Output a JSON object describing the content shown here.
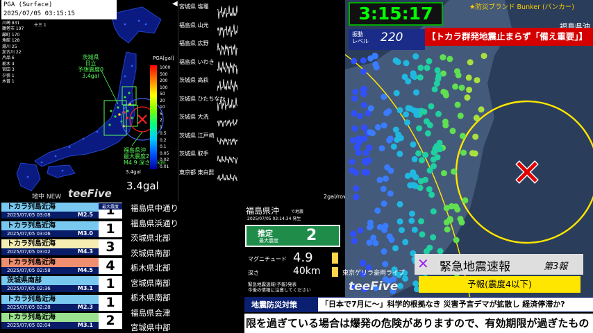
{
  "pga": {
    "title": "PGA (Surface)",
    "timestamp": "2025/07/05 03:15:15",
    "station_counts": [
      "川崎 831",
      "鶴巻市 197",
      "厳町 170",
      "角館 128",
      "湯川 25",
      "加古川 22",
      "片品 6",
      "栃木 4",
      "宮田 3",
      "夕張 1",
      "木曽 1"
    ],
    "top_tag": "十三 1",
    "ibaraki_label": [
      "茨城県",
      "日立",
      "予想震度0",
      "3.4gal"
    ],
    "fukushima_label": [
      "福島県沖",
      "最大震度2",
      "M4.9 深さ40km"
    ],
    "scale_title": "PGA[gal]",
    "scale_ticks": [
      "1000",
      "500",
      "200",
      "100",
      "50",
      "20",
      "10",
      "5",
      "2",
      "1",
      "0.5",
      "0.2",
      "0.1",
      "0.05",
      "0.02",
      "0.01"
    ],
    "min_label": "3.4gal",
    "big_value": "3.4gal",
    "brand_new": "地中 NEW",
    "brand_logo": "teeFive"
  },
  "waveforms": {
    "axis_label": "◀",
    "unit": "2gal/row",
    "stations": [
      "宮城県 塩竈",
      "福島県 山元",
      "福島県 広野",
      "福島県 いわき",
      "茨城県 高萩",
      "茨城県 ひたちなか",
      "茨城県 大洗",
      "茨城県 江戸崎",
      "茨城県 取手",
      "東京都 東白髭"
    ]
  },
  "clock": "3:15:17",
  "shindo_level": {
    "label": [
      "振動",
      "レベル"
    ],
    "value": "220"
  },
  "news_banner": "【トカラ群発地震止まらず「備え重要」】",
  "brand_bunker": "★防災ブランド Bunker (バンカー)",
  "fukushima_off_label": "福島県沖",
  "eew": {
    "title": "緊急地震速報",
    "report": "第3報",
    "forecast": "予報(震度4以下)"
  },
  "eq_info": {
    "region": "福島県沖",
    "region_tag": "で地震",
    "time": "2025/07/05 03:14:34 発生",
    "max_label": "推定",
    "max_sub": "最大震度",
    "max_value": "2",
    "mag_label": "マグニチュード",
    "mag_value": "4.9",
    "depth_label": "深さ",
    "depth_value": "40km",
    "note": [
      "緊急地震速報(予報)発表",
      "今後の情報に注意してください"
    ]
  },
  "ticker_small": "東京ゲリラ豪雨ライブ",
  "brand_logo_2": "teeFive",
  "history": {
    "max_label": "最大震度",
    "rows": [
      {
        "name": "トカラ列島近海",
        "date": "2025/07/05 03:08",
        "mag": "M2.5",
        "shindo": "1",
        "color": "#79c8f0"
      },
      {
        "name": "トカラ列島近海",
        "date": "2025/07/05 03:06",
        "mag": "M3.0",
        "shindo": "1",
        "color": "#79c8f0"
      },
      {
        "name": "トカラ列島近海",
        "date": "2025/07/05 03:02",
        "mag": "M4.3",
        "shindo": "3",
        "color": "#f4ecb2"
      },
      {
        "name": "トカラ列島近海",
        "date": "2025/07/05 02:58",
        "mag": "M4.5",
        "shindo": "4",
        "color": "#f08f70"
      },
      {
        "name": "茨城県南部",
        "date": "2025/07/05 02:36",
        "mag": "M3.1",
        "shindo": "1",
        "color": "#79c8f0"
      },
      {
        "name": "トカラ列島近海",
        "date": "2025/07/05 02:28",
        "mag": "M2.3",
        "shindo": "1",
        "color": "#79c8f0"
      },
      {
        "name": "トカラ列島近海",
        "date": "2025/07/05 02:04",
        "mag": "M3.1",
        "shindo": "2",
        "color": "#9be28f"
      }
    ]
  },
  "regions": [
    "福島県中通り",
    "福島県浜通り",
    "茨城県北部",
    "茨城県南部",
    "栃木県北部",
    "宮城県南部",
    "栃木県南部",
    "福島県会津",
    "宮城県中部"
  ],
  "topic": {
    "label": "地震防災対策",
    "text": "「日本で7月に〜」科学的根拠なき 災害予言デマが拡散し 経済停滞か?"
  },
  "scroll_ticker": "限を過ぎている場合は爆発の危険がありますので、有効期限が過ぎたもの"
}
